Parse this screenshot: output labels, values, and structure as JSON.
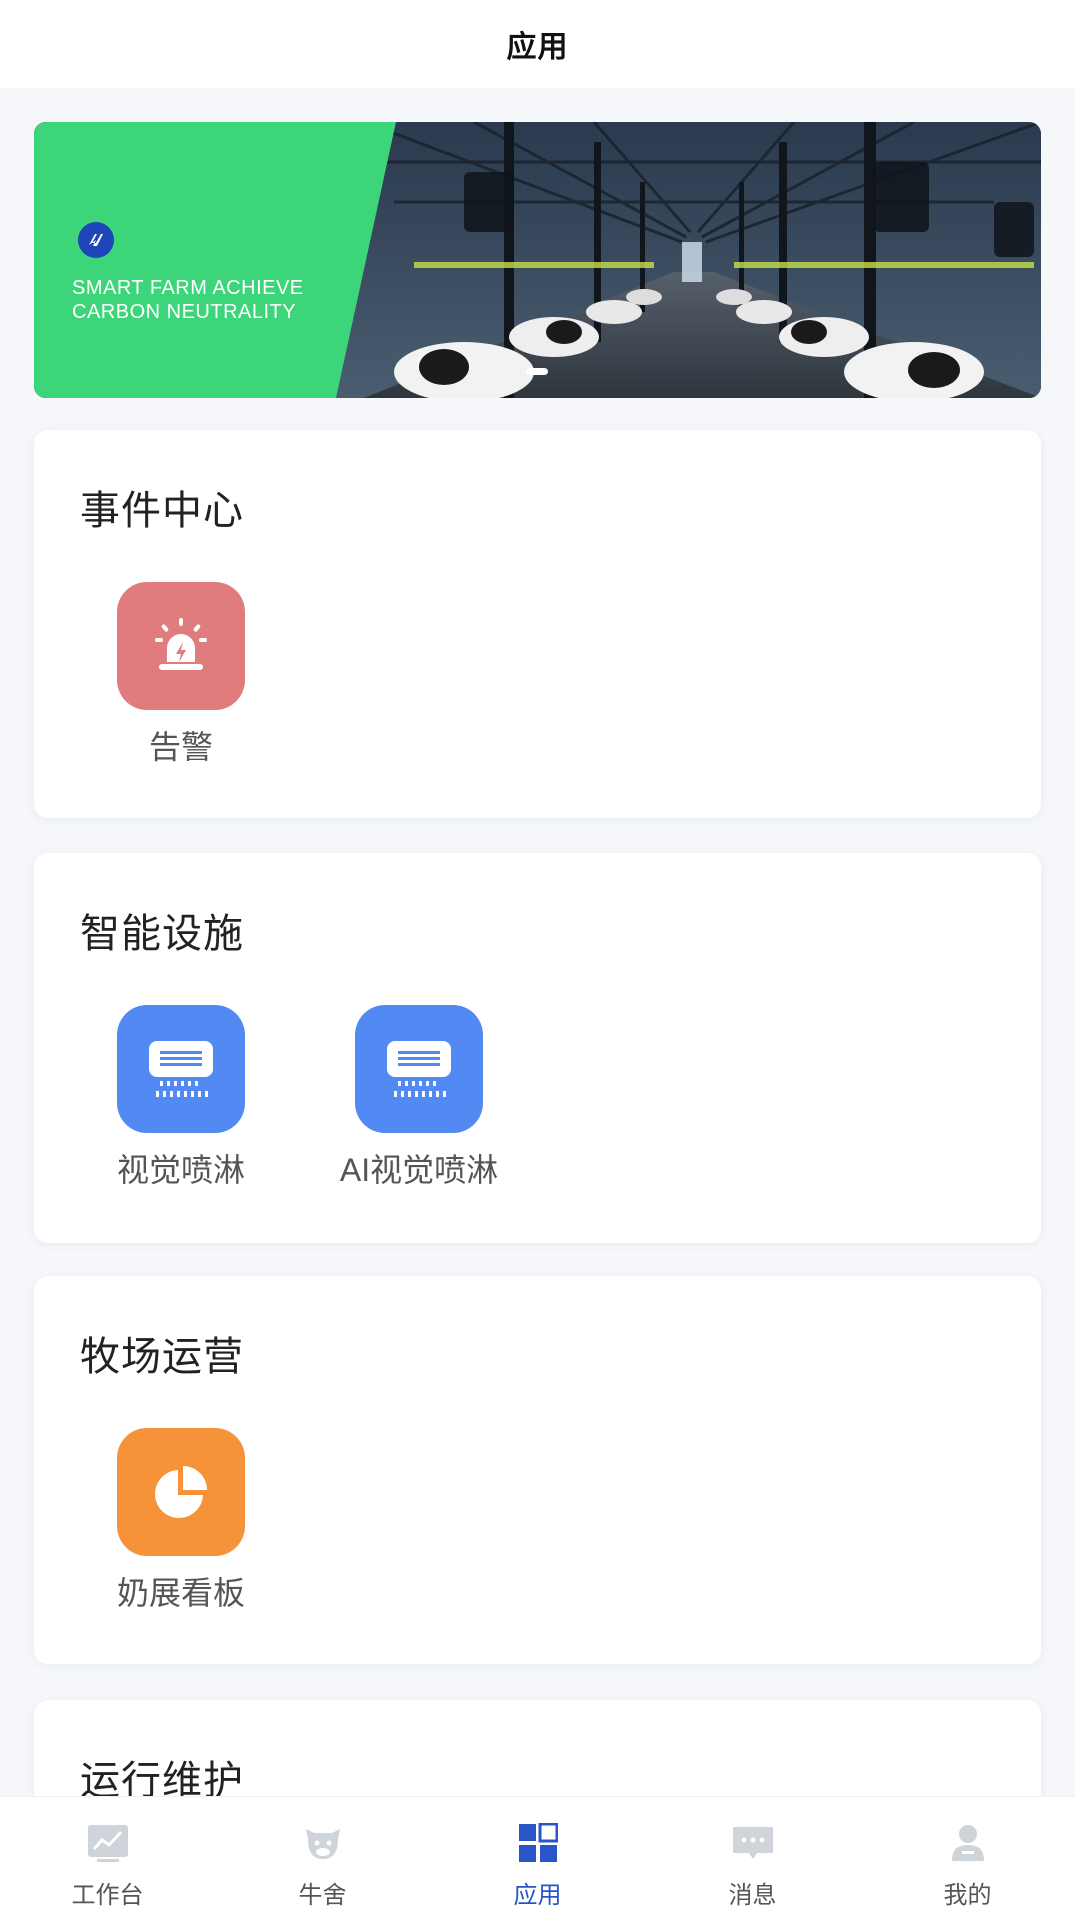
{
  "header": {
    "title": "应用"
  },
  "banner": {
    "slogan_line1": "SMART FARM ACHIEVE",
    "slogan_line2": "CARBON NEUTRALITY",
    "green_color": "#3dd57a"
  },
  "sections": [
    {
      "title": "事件中心",
      "apps": [
        {
          "label": "告警",
          "icon": "alarm-siren-icon",
          "color": "#e07c7e"
        }
      ]
    },
    {
      "title": "智能设施",
      "apps": [
        {
          "label": "视觉喷淋",
          "icon": "sprinkler-icon",
          "color": "#5389f2"
        },
        {
          "label": "AI视觉喷淋",
          "icon": "sprinkler-icon",
          "color": "#5389f2"
        }
      ]
    },
    {
      "title": "牧场运营",
      "apps": [
        {
          "label": "奶展看板",
          "icon": "pie-chart-icon",
          "color": "#f6923a"
        }
      ]
    },
    {
      "title": "运行维护",
      "apps": []
    }
  ],
  "tabbar": {
    "active": "应用",
    "items": [
      {
        "label": "工作台",
        "icon": "chart-icon"
      },
      {
        "label": "牛舍",
        "icon": "cow-icon"
      },
      {
        "label": "应用",
        "icon": "apps-grid-icon"
      },
      {
        "label": "消息",
        "icon": "message-icon"
      },
      {
        "label": "我的",
        "icon": "profile-icon"
      }
    ],
    "active_color": "#2a55c8",
    "inactive_color": "#cfd3da"
  }
}
